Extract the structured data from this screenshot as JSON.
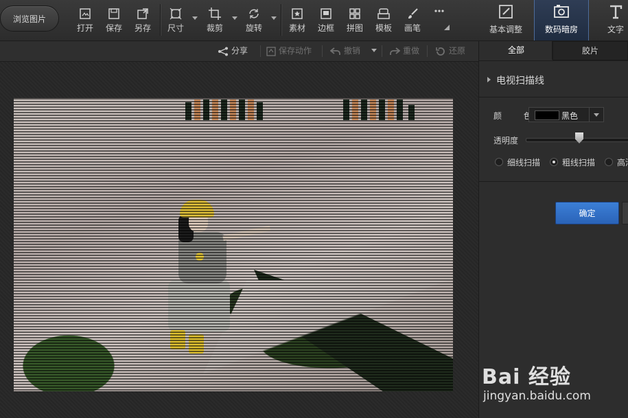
{
  "toolbar": {
    "browse_label": "浏览图片",
    "tools": [
      {
        "label": "打开",
        "icon": "open-icon"
      },
      {
        "label": "保存",
        "icon": "save-icon"
      },
      {
        "label": "另存",
        "icon": "save-as-icon"
      },
      {
        "label": "尺寸",
        "icon": "resize-icon"
      },
      {
        "label": "裁剪",
        "icon": "crop-icon"
      },
      {
        "label": "旋转",
        "icon": "rotate-icon"
      },
      {
        "label": "素材",
        "icon": "material-icon"
      },
      {
        "label": "边框",
        "icon": "border-icon"
      },
      {
        "label": "拼图",
        "icon": "collage-icon"
      },
      {
        "label": "模板",
        "icon": "template-icon"
      },
      {
        "label": "画笔",
        "icon": "brush-icon"
      }
    ],
    "more_icon": "more-icon",
    "modes": [
      {
        "label": "基本调整",
        "icon": "basic-adjust-icon"
      },
      {
        "label": "数码暗房",
        "icon": "darkroom-icon",
        "active": true
      },
      {
        "label": "文字",
        "icon": "text-icon"
      }
    ]
  },
  "actions": {
    "share": "分享",
    "save_action": "保存动作",
    "undo": "撤销",
    "redo": "重做",
    "restore": "还原"
  },
  "panel": {
    "tabs": [
      "全部",
      "胶片"
    ],
    "active_tab": "全部",
    "section_title": "电视扫描线",
    "color_label": "颜 色",
    "color_value": "黑色",
    "color_swatch": "#000000",
    "opacity_label": "透明度",
    "opacity_level": 0.52,
    "scan_options": [
      "细线扫描",
      "粗线扫描",
      "高清"
    ],
    "selected_scan": "粗线扫描",
    "confirm_label": "确定"
  },
  "watermark": {
    "main": "Bai 经验",
    "sub": "jingyan.baidu.com"
  },
  "colors": {
    "accent": "#2f6cc4",
    "active_mode_bg": "#26344a",
    "background": "#2b2b2b"
  }
}
